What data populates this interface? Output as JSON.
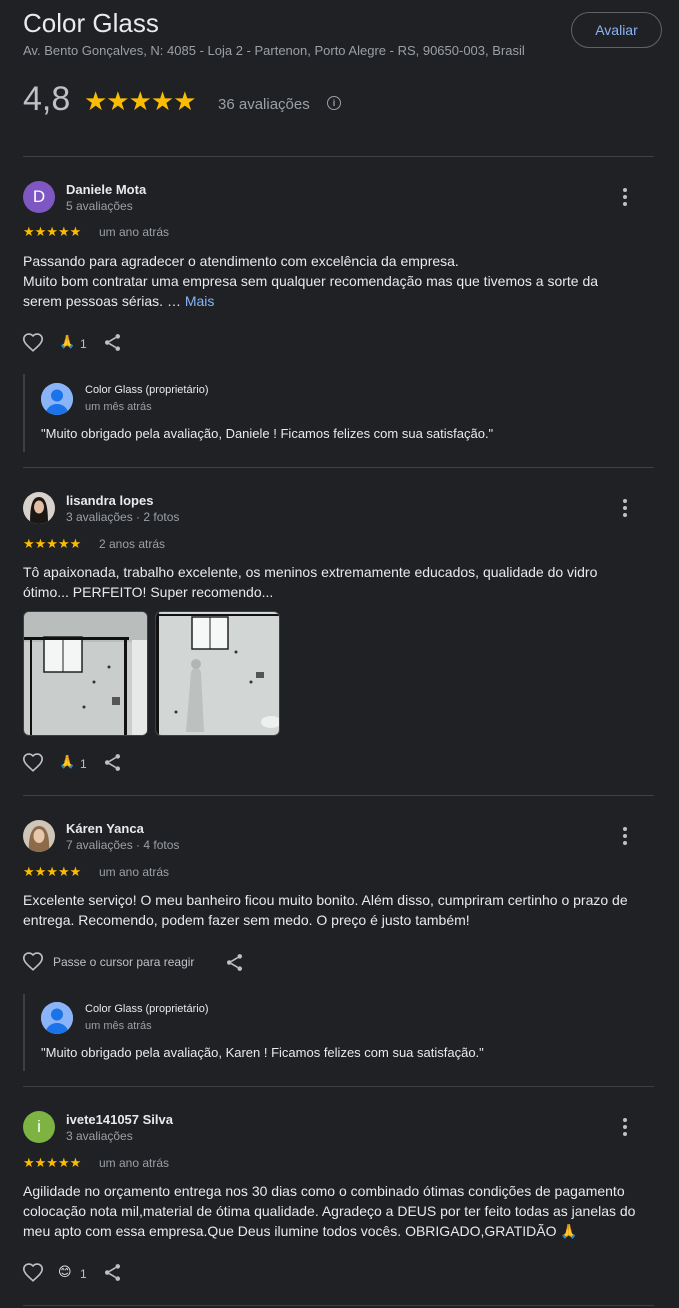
{
  "header": {
    "title": "Color Glass",
    "address": "Av. Bento Gonçalves, N: 4085 - Loja 2 - Partenon, Porto Alegre - RS, 90650-003, Brasil",
    "rate_button": "Avaliar",
    "rating": "4,8",
    "stars": "★★★★★",
    "reviews_count": "36 avaliações",
    "info_icon": "i"
  },
  "reviews": [
    {
      "avatar_letter": "D",
      "avatar_color": "#7e57c2",
      "name": "Daniele Mota",
      "meta": "5 avaliações",
      "stars": "★★★★★",
      "date": "um ano atrás",
      "text_line1": "Passando para agradecer o atendimento com excelência da empresa.",
      "text_line2": "Muito bom contratar uma empresa sem qualquer recomendação mas que tivemos a sorte da",
      "text_line3": "serem pessoas sérias. …",
      "more": "Mais",
      "reaction_count": "1",
      "owner": {
        "name": "Color Glass (proprietário)",
        "date": "um mês atrás",
        "text": "\"Muito obrigado pela avaliação, Daniele ! Ficamos felizes com sua satisfação.\""
      }
    },
    {
      "name": "lisandra lopes",
      "meta": "3 avaliações · 2 fotos",
      "stars": "★★★★★",
      "date": "2 anos atrás",
      "text_line1": "Tô apaixonada, trabalho excelente, os meninos extremamente educados, qualidade do vidro",
      "text_line2": "ótimo... PERFEITO! Super recomendo...",
      "reaction_count": "1"
    },
    {
      "name": "Káren Yanca",
      "meta": "7 avaliações · 4 fotos",
      "stars": "★★★★★",
      "date": "um ano atrás",
      "text_line1": "Excelente serviço! O meu banheiro ficou muito bonito. Além disso, cumpriram certinho o prazo de",
      "text_line2": "entrega. Recomendo, podem fazer sem medo. O preço é justo também!",
      "hover_hint": "Passe o cursor para reagir",
      "owner": {
        "name": "Color Glass (proprietário)",
        "date": "um mês atrás",
        "text": "\"Muito obrigado pela avaliação, Karen ! Ficamos felizes com sua satisfação.\""
      }
    },
    {
      "avatar_letter": "i",
      "avatar_color": "#7cb342",
      "name": "ivete141057 Silva",
      "meta": "3 avaliações",
      "stars": "★★★★★",
      "date": "um ano atrás",
      "text_line1": "Agilidade no orçamento entrega nos 30 dias como o combinado ótimas condições de pagamento",
      "text_line2": "colocação nota mil,material de ótima qualidade. Agradeço a DEUS por ter feito todas as janelas do",
      "text_line3": "meu apto com essa empresa.Que Deus ilumine todos vocês. OBRIGADO,GRATIDÃO 🙏",
      "reaction_count": "1"
    }
  ],
  "icons": {
    "like": "heart-icon",
    "share": "share-icon",
    "more": "more-vert-icon",
    "pray": "🙏",
    "smile": "😊"
  }
}
